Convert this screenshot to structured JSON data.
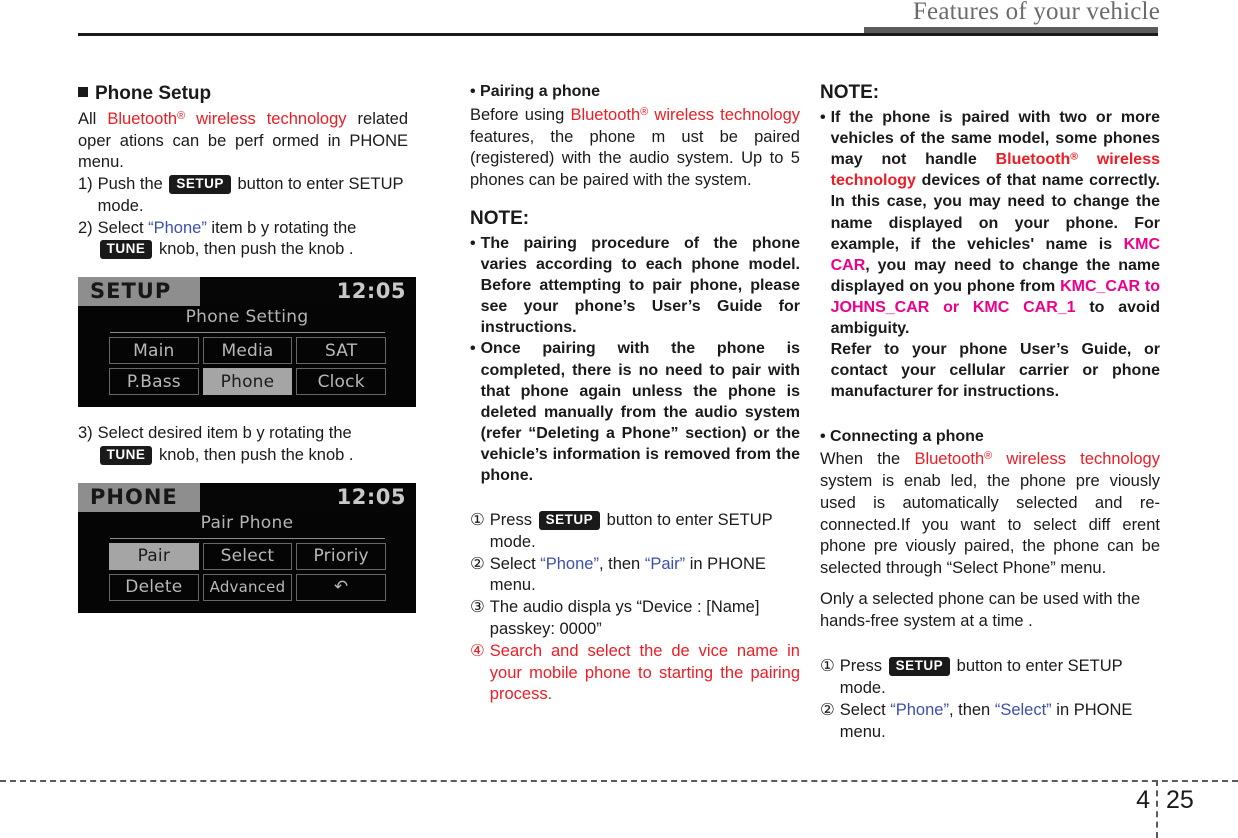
{
  "header": {
    "title": "Features of your vehicle"
  },
  "footer": {
    "chapter": "4",
    "page": "25"
  },
  "colors": {
    "bluetooth_red": "#ee1c25",
    "menu_blue": "#3b4fae",
    "name_pink": "#ec008c",
    "header_gray": "#6b6b6b"
  },
  "left_column": {
    "heading": "Phone Setup",
    "intro": {
      "t1": "All ",
      "bt": "Bluetooth",
      "sup": "®",
      "bt2": " wireless technology",
      "t2": " related oper ations can be perf    ormed in PHONE menu."
    },
    "steps": [
      {
        "marker": "1)",
        "pre": "Push the ",
        "key": "SETUP",
        "post": " button to enter SETUP mode."
      },
      {
        "marker": "2)",
        "pre": "Select ",
        "quoted": "“Phone”",
        "mid": " item b y rotating the ",
        "key": "TUNE",
        "post": " knob, then push the knob ."
      },
      {
        "marker": "3)",
        "pre": "Select desired item b    y rotating the ",
        "key": "TUNE",
        "post": " knob, then push the knob ."
      }
    ],
    "screen_setup": {
      "mode": "SETUP",
      "clock": "12:05",
      "subtitle": "Phone Setting",
      "buttons": [
        {
          "label": "Main",
          "selected": false
        },
        {
          "label": "Media",
          "selected": false
        },
        {
          "label": "SAT",
          "selected": false
        },
        {
          "label": "P.Bass",
          "selected": false
        },
        {
          "label": "Phone",
          "selected": true
        },
        {
          "label": "Clock",
          "selected": false
        }
      ]
    },
    "screen_phone": {
      "mode": "PHONE",
      "clock": "12:05",
      "subtitle": "Pair Phone",
      "buttons": [
        {
          "label": "Pair",
          "selected": true
        },
        {
          "label": "Select",
          "selected": false
        },
        {
          "label": "Prioriy",
          "selected": false
        },
        {
          "label": "Delete",
          "selected": false
        },
        {
          "label": "Advanced",
          "selected": false
        },
        {
          "label": "↶",
          "selected": false
        }
      ]
    }
  },
  "mid_column": {
    "heading": "• Pairing a phone",
    "intro": {
      "t1": "Before using ",
      "bt": "Bluetooth",
      "sup": "®",
      "bt2": " wireless technology",
      "t2": " features, the phone m    ust be paired (registered) with the audio system. Up to 5 phones can be paired with the system."
    },
    "note_heading": "NOTE:",
    "notes": [
      {
        "marker": "•",
        "text": "The pairing procedure of the phone varies according to each phone model. Before attempting to pair phone, please see your phone’s User’s Guide for instructions."
      },
      {
        "marker": "•",
        "text": "Once pairing with the phone is completed, there is no need to pair with that phone again unless the phone is deleted manually from the audio system (refer “Deleting a Phone” section) or the vehicle’s information is removed from the phone."
      }
    ],
    "procedure": [
      {
        "marker": "①",
        "pre": "Press ",
        "key": "SETUP",
        "post": " button to enter SETUP mode."
      },
      {
        "marker": "②",
        "pre": "Select ",
        "q1": "“Phone”",
        "mid": ", then ",
        "q2": "“Pair”",
        "post": " in PHONE menu."
      },
      {
        "marker": "③",
        "text": "The audio displa ys  “Device :  [Name] passkey: 0000”"
      },
      {
        "marker": "④",
        "text": "Search and select the de vice name in your mobile phone to starting the pairing process.",
        "color": "red"
      }
    ]
  },
  "right_column": {
    "note_heading": "NOTE:",
    "note": {
      "marker": "•",
      "p1": "If the phone is paired with two or more vehicles of the same model, some phones may not handle ",
      "bt": "Bluetooth",
      "sup": "®",
      "bt2": " wireless technology",
      "p2": " devices of that name correctly. In this case, you may need to change the name displayed on your phone. For example, if the vehicles' name is ",
      "name1": "KMC CAR",
      "p3": ", you may need to change the name displayed on you phone from ",
      "name2": "KMC_CAR to JOHNS_CAR or KMC CAR_1",
      "p4": " to avoid ambiguity.",
      "p5": "Refer to your phone User’s Guide, or contact your cellular carrier or phone manufacturer for instructions."
    },
    "heading2": "• Connecting a phone",
    "body1": {
      "t1": "When the ",
      "bt": "Bluetooth",
      "sup": "®",
      "bt2": " wireless technology",
      "t2": " system is enab led, the phone pre viously used is automatically selected and re-connected.If you want to select diff    erent phone pre   viously paired, the phone can be selected through “Select Phone” menu."
    },
    "body2": "Only a selected phone can be used with the hands-free system at a time .",
    "procedure": [
      {
        "marker": "①",
        "pre": "Press ",
        "key": "SETUP",
        "post": " button to enter SETUP mode."
      },
      {
        "marker": "②",
        "pre": "Select ",
        "q1": "“Phone”",
        "mid": ", then ",
        "q2": "“Select”",
        "post": " in PHONE menu."
      }
    ]
  }
}
